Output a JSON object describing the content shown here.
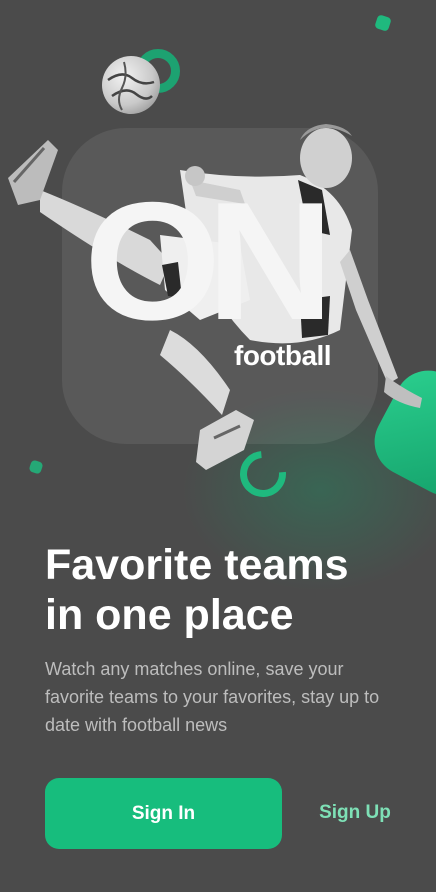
{
  "hero": {
    "logo_main": "ON",
    "logo_sub": "football"
  },
  "onboarding": {
    "headline_line1": "Favorite teams",
    "headline_line2": "in one place",
    "description": "Watch any matches online, save your favorite teams to your favorites, stay up to date with football news"
  },
  "actions": {
    "sign_in_label": "Sign In",
    "sign_up_label": "Sign Up"
  },
  "colors": {
    "background": "#4b4b4b",
    "accent": "#17bd7d",
    "accent_light": "#7ee0b6",
    "text_primary": "#ffffff",
    "text_secondary": "#bdbdbd"
  },
  "icons": [
    "soccer-ball-icon",
    "ring-decoration-icon"
  ]
}
